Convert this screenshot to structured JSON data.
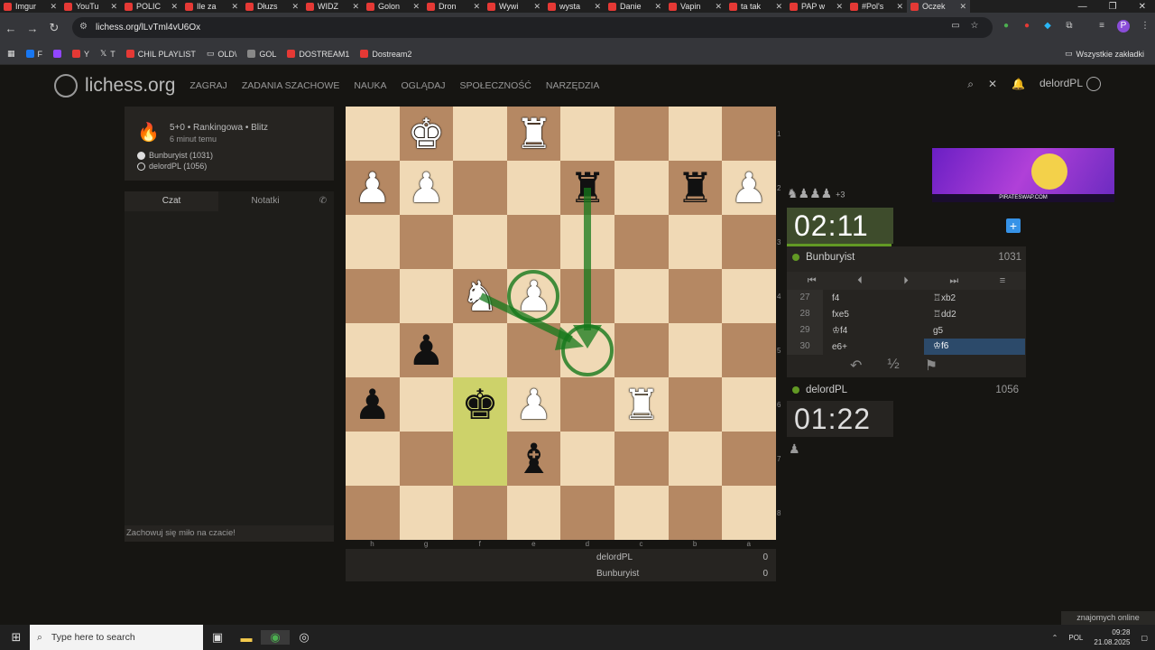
{
  "browser": {
    "tabs": [
      "Imgur",
      "YouTu",
      "POLIC",
      "Ile za",
      "Dłuzs",
      "WIDZ",
      "Golon",
      "Dron",
      "Wywi",
      "wysta",
      "Danie",
      "Vapin",
      "ta tak",
      "PAP w",
      "#Pol's",
      "Oczek"
    ],
    "url": "lichess.org/lLvTml4vU6Ox",
    "bookmarks": [
      "F",
      "Y",
      "T",
      "CHIL PLAYLIST",
      "OLD\\",
      "GOL",
      "DOSTREAM1",
      "Dostream2"
    ],
    "all_bookmarks": "Wszystkie zakładki"
  },
  "site": {
    "logo": "lichess.org",
    "nav": [
      "ZAGRAJ",
      "ZADANIA SZACHOWE",
      "NAUKA",
      "OGLĄDAJ",
      "SPOŁECZNOŚĆ",
      "NARZĘDZIA"
    ],
    "username": "delordPL"
  },
  "game": {
    "type": "5+0 • Rankingowa • Blitz",
    "time_ago": "6 minut temu",
    "player1": "Bunburyist (1031)",
    "player2": "delordPL (1056)"
  },
  "chat": {
    "tab_chat": "Czat",
    "tab_notes": "Notatki",
    "footer": "Zachowuj się miło na czacie!"
  },
  "board": {
    "ranks": [
      "1",
      "2",
      "3",
      "4",
      "5",
      "6",
      "7",
      "8"
    ],
    "files": [
      "h",
      "g",
      "f",
      "e",
      "d",
      "c",
      "b",
      "a"
    ],
    "rows": [
      [
        "",
        "wK",
        "",
        "wR",
        "",
        "",
        "",
        ""
      ],
      [
        "wP",
        "wP",
        "",
        "",
        "bR",
        "",
        "bR",
        "wP"
      ],
      [
        "",
        "",
        "",
        "",
        "",
        "",
        "",
        ""
      ],
      [
        "",
        "",
        "wN",
        "wP",
        "",
        "",
        "",
        ""
      ],
      [
        "",
        "bP",
        "",
        "",
        "",
        "",
        "",
        ""
      ],
      [
        "bP",
        "",
        "bK",
        "wP",
        "",
        "wR",
        "",
        ""
      ],
      [
        "",
        "",
        "",
        "bB",
        "",
        "",
        "",
        ""
      ],
      [
        "",
        "",
        "",
        "",
        "",
        "",
        "",
        ""
      ]
    ]
  },
  "score": {
    "p1": "delordPL",
    "p1_score": "0",
    "p2": "Bunburyist",
    "p2_score": "0"
  },
  "panel": {
    "material": "+3",
    "top_clock": "02:11",
    "bottom_clock": "01:22",
    "top_player": "Bunburyist",
    "top_rating": "1031",
    "bottom_player": "delordPL",
    "bottom_rating": "1056",
    "moves": [
      {
        "n": "27",
        "w": "f4",
        "b": "♖xb2"
      },
      {
        "n": "28",
        "w": "fxe5",
        "b": "♖dd2"
      },
      {
        "n": "29",
        "w": "♔f4",
        "b": "g5"
      },
      {
        "n": "30",
        "w": "e6+",
        "b": "♔f6"
      }
    ],
    "draw": "½"
  },
  "friends": "znajomych online",
  "taskbar": {
    "search": "Type here to search",
    "lang": "POL",
    "time": "09:28",
    "date": "21.08.2025"
  }
}
